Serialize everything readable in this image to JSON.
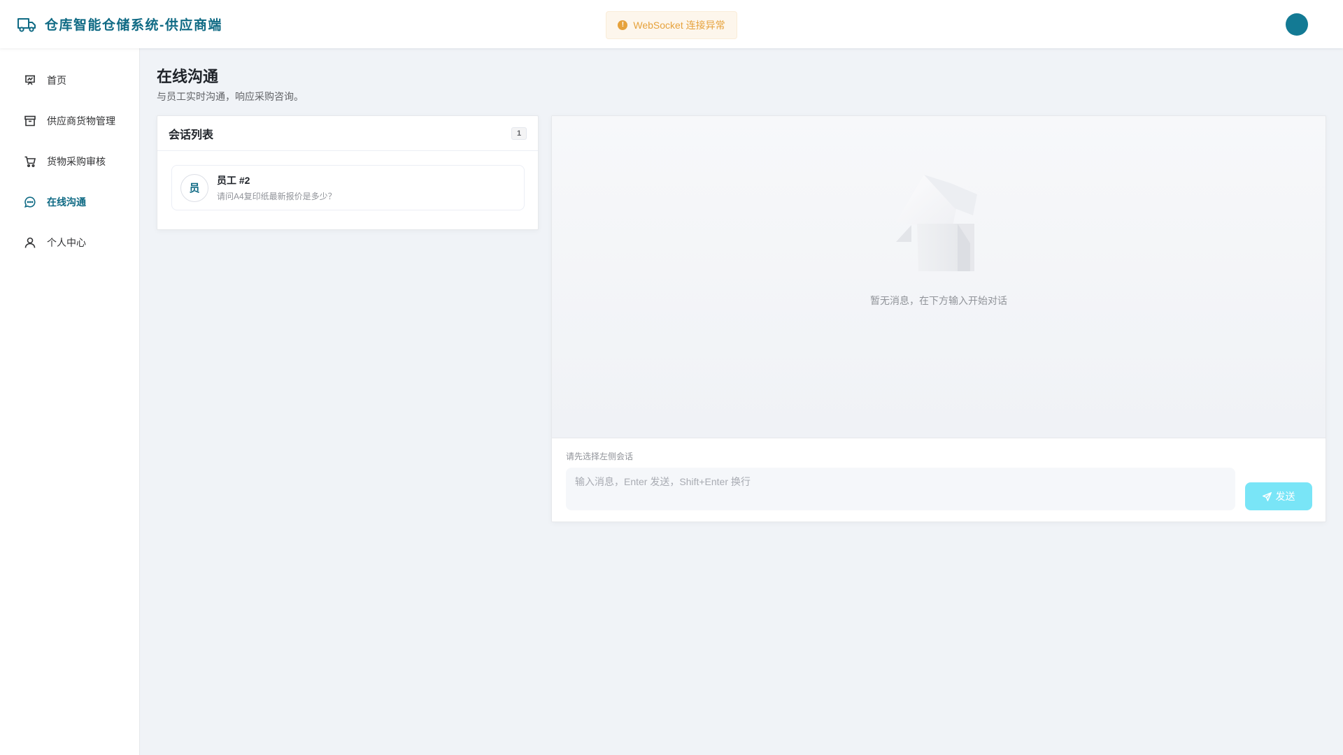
{
  "header": {
    "title": "仓库智能仓储系统-供应商端",
    "alert": "WebSocket 连接异常",
    "brand_color": "#0f6a84",
    "avatar_color": "#137a94"
  },
  "sidebar": {
    "items": [
      {
        "label": "首页",
        "icon": "dashboard-icon",
        "active": false
      },
      {
        "label": "供应商货物管理",
        "icon": "archive-box-icon",
        "active": false
      },
      {
        "label": "货物采购审核",
        "icon": "shopping-cart-icon",
        "active": false
      },
      {
        "label": "在线沟通",
        "icon": "chat-bubble-icon",
        "active": true
      },
      {
        "label": "个人中心",
        "icon": "user-icon",
        "active": false
      }
    ]
  },
  "main": {
    "title": "在线沟通",
    "subtitle": "与员工实时沟通，响应采购咨询。"
  },
  "conversations": {
    "title": "会话列表",
    "count": "1",
    "items": [
      {
        "avatar": "员",
        "name": "员工 #2",
        "preview": "请问A4复印纸最新报价是多少？"
      }
    ]
  },
  "chat": {
    "empty_text": "暂无消息，在下方输入开始对话",
    "hint": "请先选择左侧会话",
    "input_placeholder": "输入消息，Enter 发送，Shift+Enter 换行",
    "send_label": "发送",
    "send_color": "#79e5f7"
  }
}
